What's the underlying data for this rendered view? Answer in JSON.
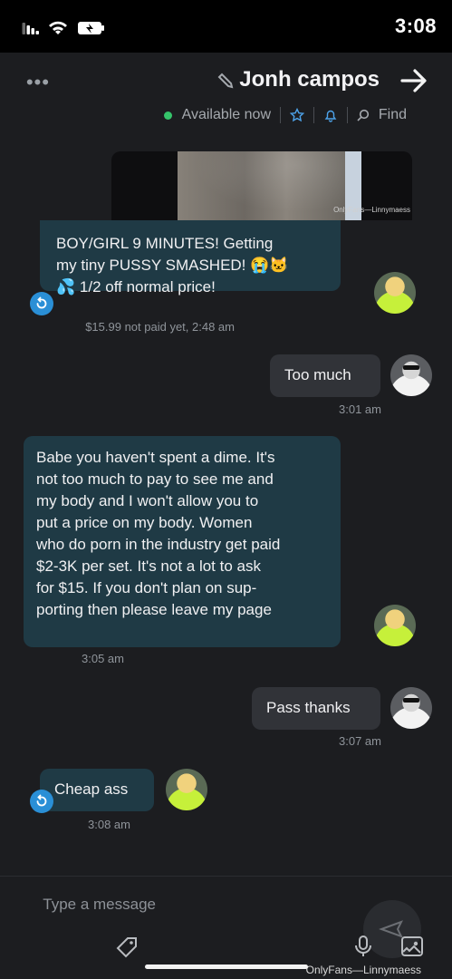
{
  "status_bar": {
    "time": "3:08"
  },
  "header": {
    "contact_name": "Jonh campos",
    "availability": "Available now",
    "find_label": "Find"
  },
  "messages": {
    "m1": {
      "text": "BOY/GIRL 9 MINUTES! Getting\nmy tiny PUSSY SMASHED! 😭🐱\n💦 1/2 off normal price!",
      "meta": "$15.99 not paid yet, 2:48 am",
      "media_watermark": "OnlyFans—Linnymaess"
    },
    "m2": {
      "text": "Too much",
      "meta": "3:01 am"
    },
    "m3": {
      "text": "Babe you haven't spent a dime. It's\nnot too much to pay to see me and\nmy body and I won't allow you to\nput a price on my body. Women\nwho do porn in the industry get paid\n$2-3K per set. It's not a lot to ask\nfor $15. If you don't plan on sup-\nporting then please leave my page",
      "meta": "3:05 am"
    },
    "m4": {
      "text": "Pass thanks",
      "meta": "3:07 am"
    },
    "m5": {
      "text": "Cheap ass",
      "meta": "3:08 am"
    }
  },
  "composer": {
    "placeholder": "Type a message",
    "watermark": "OnlyFans—Linnymaess"
  },
  "colors": {
    "background": "#1c1d20",
    "incoming_bubble": "#1f3a45",
    "outgoing_bubble": "#313338",
    "accent": "#2a8fd6",
    "online": "#35c46a"
  }
}
